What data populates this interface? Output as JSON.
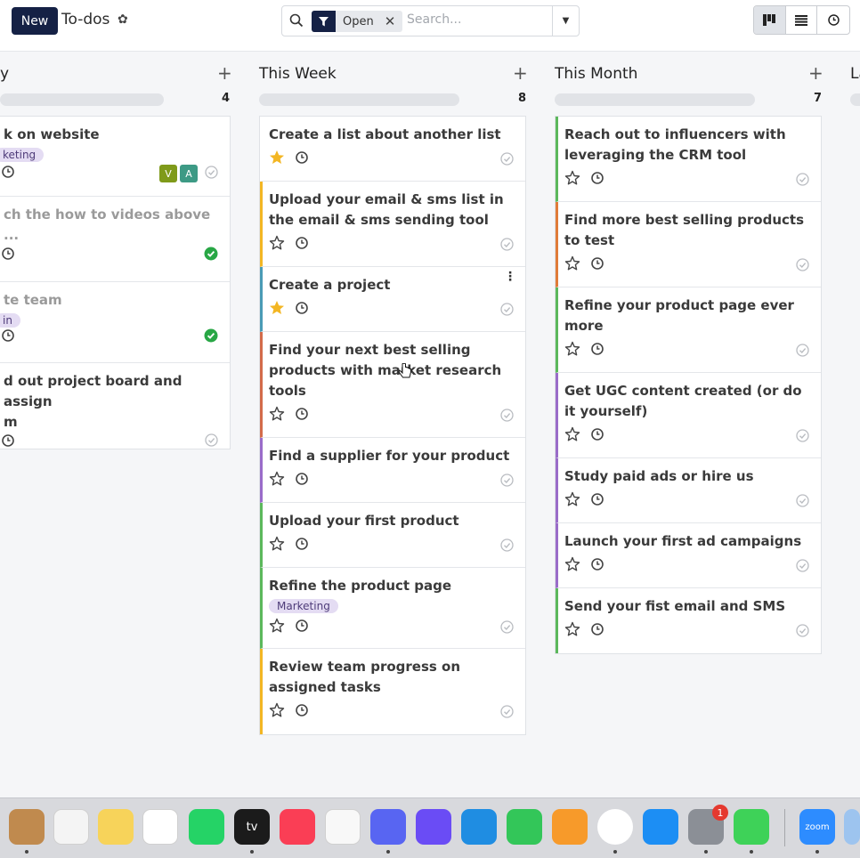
{
  "topbar": {
    "new_label": "New",
    "title": "To-dos",
    "facet_label": "Open",
    "search_placeholder": "Search..."
  },
  "columns": [
    {
      "title": "y",
      "count": "4",
      "cards": [
        {
          "title": "k on website",
          "tag": "keting",
          "avatars": [
            "V",
            "A"
          ]
        },
        {
          "title": "ch the how to videos above\n...",
          "done": true
        },
        {
          "title": "te team",
          "tag": "in",
          "done": true
        },
        {
          "title": "d out project board and assign\nm"
        }
      ]
    },
    {
      "title": "This Week",
      "count": "8",
      "cards": [
        {
          "title": "Create a list about another list",
          "starred": true
        },
        {
          "title": "Upload your email & sms list in the email & sms sending tool"
        },
        {
          "title": "Create a project",
          "starred": true
        },
        {
          "title": "Find your next best selling products with market research tools"
        },
        {
          "title": "Find a supplier for your product"
        },
        {
          "title": "Upload your first product"
        },
        {
          "title": "Refine the product page",
          "tag": "Marketing"
        },
        {
          "title": "Review team progress on assigned tasks"
        }
      ]
    },
    {
      "title": "This Month",
      "count": "7",
      "cards": [
        {
          "title": "Reach out to influencers with leveraging the CRM tool"
        },
        {
          "title": "Find more best selling products to test"
        },
        {
          "title": "Refine your product page ever more"
        },
        {
          "title": "Get UGC content created (or do it yourself)"
        },
        {
          "title": "Study paid ads or hire us"
        },
        {
          "title": "Launch your first ad campaigns"
        },
        {
          "title": "Send your fist email and SMS"
        }
      ]
    },
    {
      "title": "La"
    }
  ],
  "dock": {
    "badge": "1",
    "apps": [
      "contacts",
      "reminders",
      "notes",
      "freeform",
      "whatsapp",
      "apple-tv",
      "music",
      "news",
      "discord",
      "perplexity",
      "keynote",
      "numbers",
      "pages",
      "chrome",
      "app-store",
      "system-settings",
      "messages",
      "zoom",
      "finder"
    ],
    "tv_label": "tv",
    "zoom_label": "zoom"
  },
  "colors": {
    "brand": "#152145",
    "star_filled": "#f3b623",
    "check_done": "#28a745"
  }
}
